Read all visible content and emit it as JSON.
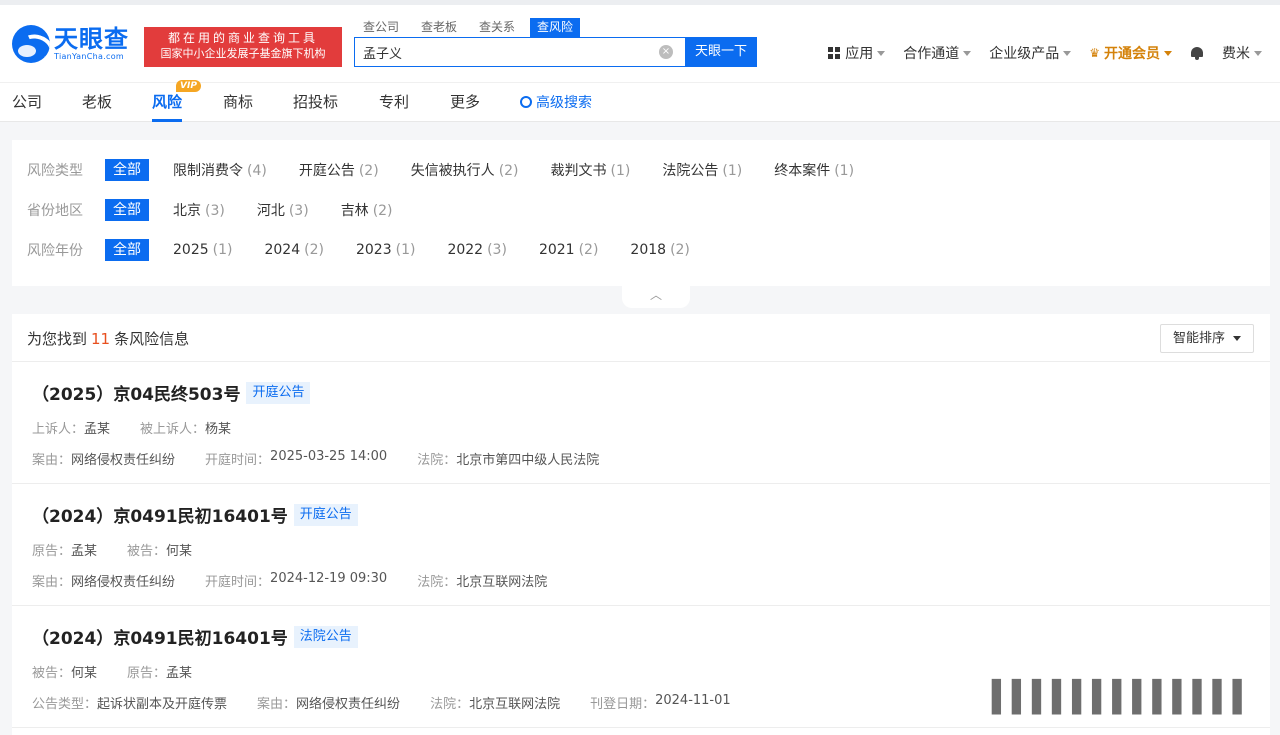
{
  "brand": {
    "name_cn": "天眼查",
    "name_en": "TianYanCha.com"
  },
  "slogan": {
    "line1": "都在用的商业查询工具",
    "line2": "国家中小企业发展子基金旗下机构"
  },
  "search": {
    "tabs": [
      "查公司",
      "查老板",
      "查关系",
      "查风险"
    ],
    "value": "孟子义",
    "button": "天眼一下"
  },
  "topnav": {
    "apps": "应用",
    "partner": "合作通道",
    "enterprise": "企业级产品",
    "vip": "开通会员",
    "user": "费米"
  },
  "categories": [
    "公司",
    "老板",
    "风险",
    "商标",
    "招投标",
    "专利",
    "更多"
  ],
  "vip_badge": "VIP",
  "advanced_search": "高级搜索",
  "filters": {
    "all": "全部",
    "risk_type": {
      "label": "风险类型",
      "options": [
        {
          "name": "限制消费令",
          "count": "(4)"
        },
        {
          "name": "开庭公告",
          "count": "(2)"
        },
        {
          "name": "失信被执行人",
          "count": "(2)"
        },
        {
          "name": "裁判文书",
          "count": "(1)"
        },
        {
          "name": "法院公告",
          "count": "(1)"
        },
        {
          "name": "终本案件",
          "count": "(1)"
        }
      ]
    },
    "province": {
      "label": "省份地区",
      "options": [
        {
          "name": "北京",
          "count": "(3)"
        },
        {
          "name": "河北",
          "count": "(3)"
        },
        {
          "name": "吉林",
          "count": "(2)"
        }
      ]
    },
    "year": {
      "label": "风险年份",
      "options": [
        {
          "name": "2025",
          "count": "(1)"
        },
        {
          "name": "2024",
          "count": "(2)"
        },
        {
          "name": "2023",
          "count": "(1)"
        },
        {
          "name": "2022",
          "count": "(3)"
        },
        {
          "name": "2021",
          "count": "(2)"
        },
        {
          "name": "2018",
          "count": "(2)"
        }
      ]
    }
  },
  "results": {
    "prefix": "为您找到",
    "count": "11",
    "suffix": "条风险信息",
    "sort": "智能排序",
    "items": [
      {
        "title": "（2025）京04民终503号",
        "tag": "开庭公告",
        "row1": [
          [
            "上诉人：",
            "孟某"
          ],
          [
            "被上诉人：",
            "杨某"
          ]
        ],
        "row2": [
          [
            "案由：",
            "网络侵权责任纠纷"
          ],
          [
            "开庭时间：",
            "2025-03-25 14:00"
          ],
          [
            "法院：",
            "北京市第四中级人民法院"
          ]
        ]
      },
      {
        "title": "（2024）京0491民初16401号",
        "tag": "开庭公告",
        "row1": [
          [
            "原告：",
            "孟某"
          ],
          [
            "被告：",
            "何某"
          ]
        ],
        "row2": [
          [
            "案由：",
            "网络侵权责任纠纷"
          ],
          [
            "开庭时间：",
            "2024-12-19 09:30"
          ],
          [
            "法院：",
            "北京互联网法院"
          ]
        ]
      },
      {
        "title": "（2024）京0491民初16401号",
        "tag": "法院公告",
        "row1": [
          [
            "被告：",
            "何某"
          ],
          [
            "原告：",
            "孟某"
          ]
        ],
        "row2": [
          [
            "公告类型：",
            "起诉状副本及开庭传票"
          ],
          [
            "案由：",
            "网络侵权责任纠纷"
          ],
          [
            "法院：",
            "北京互联网法院"
          ],
          [
            "刊登日期：",
            "2024-11-01"
          ]
        ]
      }
    ]
  }
}
